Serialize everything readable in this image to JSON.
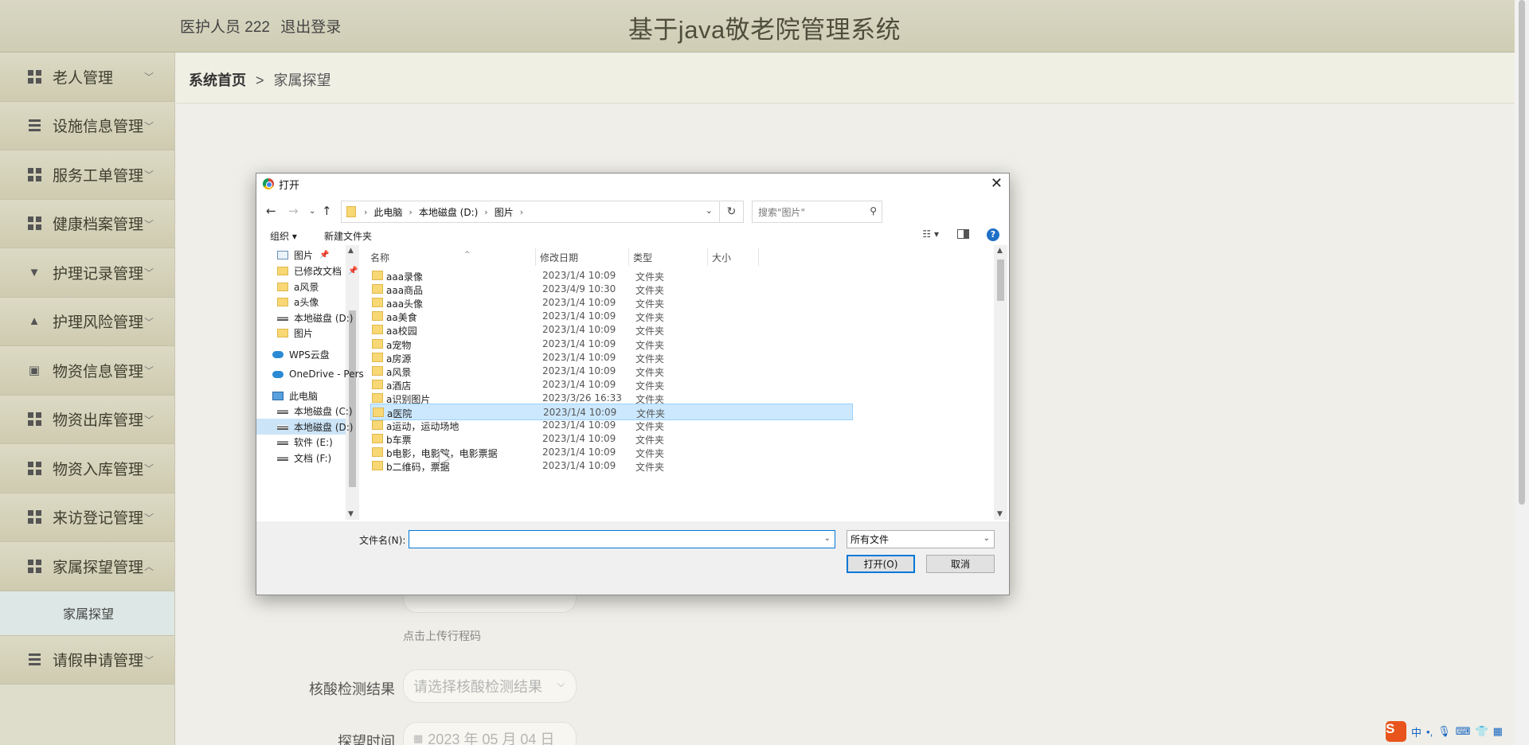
{
  "header": {
    "user_label": "医护人员 222",
    "logout_label": "退出登录",
    "title": "基于java敬老院管理系统"
  },
  "sidebar": {
    "items": [
      {
        "label": "老人管理",
        "icon": "grid"
      },
      {
        "label": "设施信息管理",
        "icon": "list"
      },
      {
        "label": "服务工单管理",
        "icon": "grid"
      },
      {
        "label": "健康档案管理",
        "icon": "grid"
      },
      {
        "label": "护理记录管理",
        "icon": "pin"
      },
      {
        "label": "护理风险管理",
        "icon": "user"
      },
      {
        "label": "物资信息管理",
        "icon": "clipboard"
      },
      {
        "label": "物资出库管理",
        "icon": "grid"
      },
      {
        "label": "物资入库管理",
        "icon": "grid"
      },
      {
        "label": "来访登记管理",
        "icon": "grid"
      },
      {
        "label": "家属探望管理",
        "icon": "grid",
        "expanded": true
      },
      {
        "label": "请假申请管理",
        "icon": "list"
      }
    ],
    "submenu": {
      "label": "家属探望"
    }
  },
  "breadcrumb": {
    "home": "系统首页",
    "separator": ">",
    "current": "家属探望"
  },
  "form": {
    "upload_hint": "点击上传行程码",
    "nucleic_label": "核酸检测结果",
    "nucleic_placeholder": "请选择核酸检测结果",
    "visit_time_label": "探望时间",
    "visit_time_value": "2023 年 05 月 04 日"
  },
  "dialog": {
    "title": "打开",
    "address": [
      "此电脑",
      "本地磁盘 (D:)",
      "图片"
    ],
    "search_placeholder": "搜索\"图片\"",
    "toolbar": {
      "organize": "组织 ▾",
      "new_folder": "新建文件夹"
    },
    "nav_pane": [
      {
        "label": "图片",
        "icon": "pic",
        "pinned": true
      },
      {
        "label": "已修改文档",
        "icon": "folder",
        "pinned": true
      },
      {
        "label": "a风景",
        "icon": "folder"
      },
      {
        "label": "a头像",
        "icon": "folder"
      },
      {
        "label": "本地磁盘 (D:)",
        "icon": "drive"
      },
      {
        "label": "图片",
        "icon": "folder"
      },
      {
        "label": "WPS云盘",
        "icon": "cloud"
      },
      {
        "label": "OneDrive - Pers",
        "icon": "cloud"
      },
      {
        "label": "此电脑",
        "icon": "pc"
      },
      {
        "label": "本地磁盘 (C:)",
        "icon": "drive"
      },
      {
        "label": "本地磁盘 (D:)",
        "icon": "drive",
        "selected": true
      },
      {
        "label": "软件 (E:)",
        "icon": "drive"
      },
      {
        "label": "文档 (F:)",
        "icon": "drive"
      }
    ],
    "columns": {
      "name": "名称",
      "date": "修改日期",
      "type": "类型",
      "size": "大小"
    },
    "files": [
      {
        "name": "aaa录像",
        "date": "2023/1/4 10:09",
        "type": "文件夹"
      },
      {
        "name": "aaa商品",
        "date": "2023/4/9 10:30",
        "type": "文件夹"
      },
      {
        "name": "aaa头像",
        "date": "2023/1/4 10:09",
        "type": "文件夹"
      },
      {
        "name": "aa美食",
        "date": "2023/1/4 10:09",
        "type": "文件夹"
      },
      {
        "name": "aa校园",
        "date": "2023/1/4 10:09",
        "type": "文件夹"
      },
      {
        "name": "a宠物",
        "date": "2023/1/4 10:09",
        "type": "文件夹"
      },
      {
        "name": "a房源",
        "date": "2023/1/4 10:09",
        "type": "文件夹"
      },
      {
        "name": "a风景",
        "date": "2023/1/4 10:09",
        "type": "文件夹"
      },
      {
        "name": "a酒店",
        "date": "2023/1/4 10:09",
        "type": "文件夹"
      },
      {
        "name": "a识别图片",
        "date": "2023/3/26 16:33",
        "type": "文件夹"
      },
      {
        "name": "a医院",
        "date": "2023/1/4 10:09",
        "type": "文件夹",
        "selected": true
      },
      {
        "name": "a运动，运动场地",
        "date": "2023/1/4 10:09",
        "type": "文件夹"
      },
      {
        "name": "b车票",
        "date": "2023/1/4 10:09",
        "type": "文件夹"
      },
      {
        "name": "b电影，电影院，电影票据",
        "date": "2023/1/4 10:09",
        "type": "文件夹"
      },
      {
        "name": "b二维码，票据",
        "date": "2023/1/4 10:09",
        "type": "文件夹"
      }
    ],
    "filename_label": "文件名(N):",
    "filename_value": "",
    "filetype_value": "所有文件",
    "open_button": "打开(O)",
    "cancel_button": "取消"
  },
  "tray": {
    "ime": "中",
    "punct": "•,"
  }
}
